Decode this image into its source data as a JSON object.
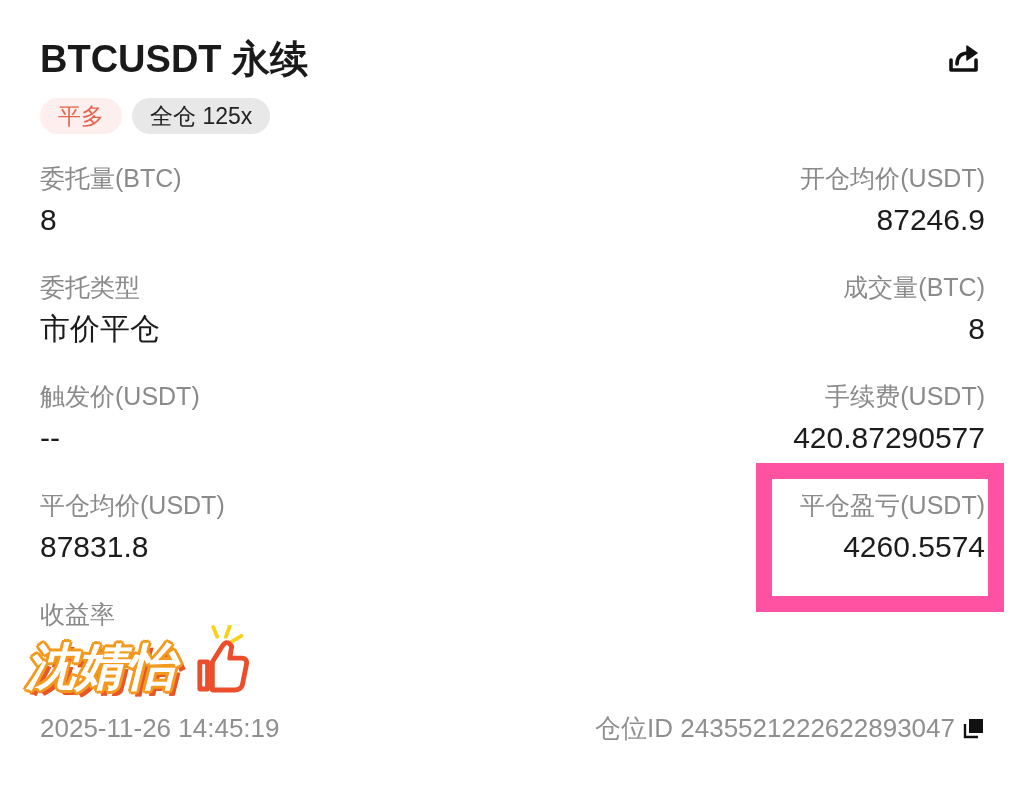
{
  "header": {
    "title": "BTCUSDT 永续",
    "tags": [
      {
        "text": "平多",
        "color": "#e5654c"
      },
      {
        "text": "全仓 125x",
        "color": "#222222"
      }
    ]
  },
  "fields": [
    {
      "label": "委托量(BTC)",
      "value": "8",
      "highlighted": false
    },
    {
      "label": "开仓均价(USDT)",
      "value": "87246.9",
      "highlighted": false
    },
    {
      "label": "委托类型",
      "value": "市价平仓",
      "highlighted": false
    },
    {
      "label": "成交量(BTC)",
      "value": "8",
      "highlighted": false
    },
    {
      "label": "触发价(USDT)",
      "value": "--",
      "highlighted": false
    },
    {
      "label": "手续费(USDT)",
      "value": "420.87290577",
      "highlighted": false
    },
    {
      "label": "平仓均价(USDT)",
      "value": "87831.8",
      "highlighted": false
    },
    {
      "label": "平仓盈亏(USDT)",
      "value": "4260.5574",
      "highlighted": true
    },
    {
      "label": "收益率",
      "highlighted": false
    }
  ],
  "sticker": {
    "text": "沈婧怡"
  },
  "footer": {
    "time": "2025-11-26 14:45:19",
    "position_id": "仓位ID 2435521222622893047"
  }
}
